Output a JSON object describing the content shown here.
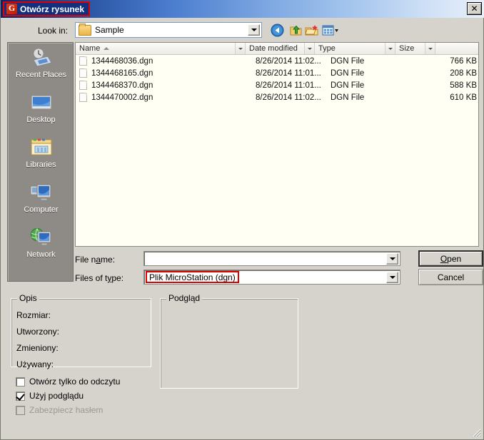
{
  "window": {
    "title": "Otwórz rysunek",
    "app_icon": "gstarcad-g-icon",
    "close_label": "✕"
  },
  "toolbar": {
    "lookin_label": "Look in:",
    "lookin_value": "Sample",
    "back_icon": "back-arrow-icon",
    "up_icon": "up-one-level-icon",
    "new_folder_icon": "new-folder-icon",
    "views_icon": "views-icon"
  },
  "places": [
    {
      "label": "Recent Places",
      "icon": "recent-places-icon"
    },
    {
      "label": "Desktop",
      "icon": "desktop-icon"
    },
    {
      "label": "Libraries",
      "icon": "libraries-icon"
    },
    {
      "label": "Computer",
      "icon": "computer-icon"
    },
    {
      "label": "Network",
      "icon": "network-icon"
    }
  ],
  "filelist": {
    "columns": [
      {
        "label": "Name",
        "sorted": "asc"
      },
      {
        "label": "Date modified",
        "sorted": ""
      },
      {
        "label": "Type",
        "sorted": ""
      },
      {
        "label": "Size",
        "sorted": ""
      }
    ],
    "rows": [
      {
        "name": "1344468036.dgn",
        "date": "8/26/2014 11:02...",
        "type": "DGN File",
        "size": "766 KB"
      },
      {
        "name": "1344468165.dgn",
        "date": "8/26/2014 11:01...",
        "type": "DGN File",
        "size": "208 KB"
      },
      {
        "name": "1344468370.dgn",
        "date": "8/26/2014 11:01...",
        "type": "DGN File",
        "size": "588 KB"
      },
      {
        "name": "1344470002.dgn",
        "date": "8/26/2014 11:02...",
        "type": "DGN File",
        "size": "610 KB"
      }
    ]
  },
  "fields": {
    "filename_label": "File name:",
    "filename_value": "",
    "filetype_label": "Files of type:",
    "filetype_value": "Plik MicroStation (dgn)"
  },
  "buttons": {
    "open": "Open",
    "cancel": "Cancel"
  },
  "description_group": {
    "legend": "Opis",
    "rows": [
      "Rozmiar:",
      "Utworzony:",
      "Zmieniony:",
      "Używany:"
    ]
  },
  "preview_group": {
    "legend": "Podgląd"
  },
  "checkboxes": [
    {
      "label": "Otwórz tylko do odczytu",
      "checked": false,
      "disabled": false
    },
    {
      "label": "Użyj podglądu",
      "checked": true,
      "disabled": false
    },
    {
      "label": "Zabezpiecz hasłem",
      "checked": false,
      "disabled": true
    }
  ],
  "colors": {
    "highlight": "#e00000",
    "dialog_bg": "#d6d3cc",
    "list_bg": "#fffff4",
    "places_bg": "#8e8b86"
  }
}
